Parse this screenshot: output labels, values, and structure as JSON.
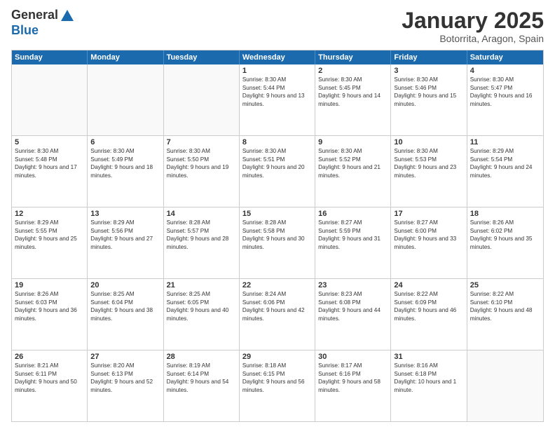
{
  "header": {
    "logo": {
      "general": "General",
      "blue": "Blue"
    },
    "title": "January 2025",
    "location": "Botorrita, Aragon, Spain"
  },
  "weekdays": [
    "Sunday",
    "Monday",
    "Tuesday",
    "Wednesday",
    "Thursday",
    "Friday",
    "Saturday"
  ],
  "weeks": [
    [
      {
        "day": "",
        "sunrise": "",
        "sunset": "",
        "daylight": ""
      },
      {
        "day": "",
        "sunrise": "",
        "sunset": "",
        "daylight": ""
      },
      {
        "day": "",
        "sunrise": "",
        "sunset": "",
        "daylight": ""
      },
      {
        "day": "1",
        "sunrise": "Sunrise: 8:30 AM",
        "sunset": "Sunset: 5:44 PM",
        "daylight": "Daylight: 9 hours and 13 minutes."
      },
      {
        "day": "2",
        "sunrise": "Sunrise: 8:30 AM",
        "sunset": "Sunset: 5:45 PM",
        "daylight": "Daylight: 9 hours and 14 minutes."
      },
      {
        "day": "3",
        "sunrise": "Sunrise: 8:30 AM",
        "sunset": "Sunset: 5:46 PM",
        "daylight": "Daylight: 9 hours and 15 minutes."
      },
      {
        "day": "4",
        "sunrise": "Sunrise: 8:30 AM",
        "sunset": "Sunset: 5:47 PM",
        "daylight": "Daylight: 9 hours and 16 minutes."
      }
    ],
    [
      {
        "day": "5",
        "sunrise": "Sunrise: 8:30 AM",
        "sunset": "Sunset: 5:48 PM",
        "daylight": "Daylight: 9 hours and 17 minutes."
      },
      {
        "day": "6",
        "sunrise": "Sunrise: 8:30 AM",
        "sunset": "Sunset: 5:49 PM",
        "daylight": "Daylight: 9 hours and 18 minutes."
      },
      {
        "day": "7",
        "sunrise": "Sunrise: 8:30 AM",
        "sunset": "Sunset: 5:50 PM",
        "daylight": "Daylight: 9 hours and 19 minutes."
      },
      {
        "day": "8",
        "sunrise": "Sunrise: 8:30 AM",
        "sunset": "Sunset: 5:51 PM",
        "daylight": "Daylight: 9 hours and 20 minutes."
      },
      {
        "day": "9",
        "sunrise": "Sunrise: 8:30 AM",
        "sunset": "Sunset: 5:52 PM",
        "daylight": "Daylight: 9 hours and 21 minutes."
      },
      {
        "day": "10",
        "sunrise": "Sunrise: 8:30 AM",
        "sunset": "Sunset: 5:53 PM",
        "daylight": "Daylight: 9 hours and 23 minutes."
      },
      {
        "day": "11",
        "sunrise": "Sunrise: 8:29 AM",
        "sunset": "Sunset: 5:54 PM",
        "daylight": "Daylight: 9 hours and 24 minutes."
      }
    ],
    [
      {
        "day": "12",
        "sunrise": "Sunrise: 8:29 AM",
        "sunset": "Sunset: 5:55 PM",
        "daylight": "Daylight: 9 hours and 25 minutes."
      },
      {
        "day": "13",
        "sunrise": "Sunrise: 8:29 AM",
        "sunset": "Sunset: 5:56 PM",
        "daylight": "Daylight: 9 hours and 27 minutes."
      },
      {
        "day": "14",
        "sunrise": "Sunrise: 8:28 AM",
        "sunset": "Sunset: 5:57 PM",
        "daylight": "Daylight: 9 hours and 28 minutes."
      },
      {
        "day": "15",
        "sunrise": "Sunrise: 8:28 AM",
        "sunset": "Sunset: 5:58 PM",
        "daylight": "Daylight: 9 hours and 30 minutes."
      },
      {
        "day": "16",
        "sunrise": "Sunrise: 8:27 AM",
        "sunset": "Sunset: 5:59 PM",
        "daylight": "Daylight: 9 hours and 31 minutes."
      },
      {
        "day": "17",
        "sunrise": "Sunrise: 8:27 AM",
        "sunset": "Sunset: 6:00 PM",
        "daylight": "Daylight: 9 hours and 33 minutes."
      },
      {
        "day": "18",
        "sunrise": "Sunrise: 8:26 AM",
        "sunset": "Sunset: 6:02 PM",
        "daylight": "Daylight: 9 hours and 35 minutes."
      }
    ],
    [
      {
        "day": "19",
        "sunrise": "Sunrise: 8:26 AM",
        "sunset": "Sunset: 6:03 PM",
        "daylight": "Daylight: 9 hours and 36 minutes."
      },
      {
        "day": "20",
        "sunrise": "Sunrise: 8:25 AM",
        "sunset": "Sunset: 6:04 PM",
        "daylight": "Daylight: 9 hours and 38 minutes."
      },
      {
        "day": "21",
        "sunrise": "Sunrise: 8:25 AM",
        "sunset": "Sunset: 6:05 PM",
        "daylight": "Daylight: 9 hours and 40 minutes."
      },
      {
        "day": "22",
        "sunrise": "Sunrise: 8:24 AM",
        "sunset": "Sunset: 6:06 PM",
        "daylight": "Daylight: 9 hours and 42 minutes."
      },
      {
        "day": "23",
        "sunrise": "Sunrise: 8:23 AM",
        "sunset": "Sunset: 6:08 PM",
        "daylight": "Daylight: 9 hours and 44 minutes."
      },
      {
        "day": "24",
        "sunrise": "Sunrise: 8:22 AM",
        "sunset": "Sunset: 6:09 PM",
        "daylight": "Daylight: 9 hours and 46 minutes."
      },
      {
        "day": "25",
        "sunrise": "Sunrise: 8:22 AM",
        "sunset": "Sunset: 6:10 PM",
        "daylight": "Daylight: 9 hours and 48 minutes."
      }
    ],
    [
      {
        "day": "26",
        "sunrise": "Sunrise: 8:21 AM",
        "sunset": "Sunset: 6:11 PM",
        "daylight": "Daylight: 9 hours and 50 minutes."
      },
      {
        "day": "27",
        "sunrise": "Sunrise: 8:20 AM",
        "sunset": "Sunset: 6:13 PM",
        "daylight": "Daylight: 9 hours and 52 minutes."
      },
      {
        "day": "28",
        "sunrise": "Sunrise: 8:19 AM",
        "sunset": "Sunset: 6:14 PM",
        "daylight": "Daylight: 9 hours and 54 minutes."
      },
      {
        "day": "29",
        "sunrise": "Sunrise: 8:18 AM",
        "sunset": "Sunset: 6:15 PM",
        "daylight": "Daylight: 9 hours and 56 minutes."
      },
      {
        "day": "30",
        "sunrise": "Sunrise: 8:17 AM",
        "sunset": "Sunset: 6:16 PM",
        "daylight": "Daylight: 9 hours and 58 minutes."
      },
      {
        "day": "31",
        "sunrise": "Sunrise: 8:16 AM",
        "sunset": "Sunset: 6:18 PM",
        "daylight": "Daylight: 10 hours and 1 minute."
      },
      {
        "day": "",
        "sunrise": "",
        "sunset": "",
        "daylight": ""
      }
    ]
  ]
}
